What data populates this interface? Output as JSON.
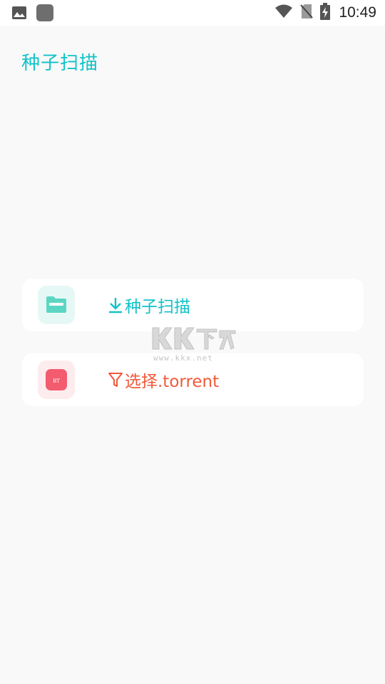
{
  "status_bar": {
    "time": "10:49",
    "icons": [
      "image-icon",
      "app-square-icon",
      "wifi-icon",
      "no-sim-icon",
      "battery-charging-icon"
    ]
  },
  "app": {
    "title": "种子扫描"
  },
  "actions": [
    {
      "label": "种子扫描",
      "icon": "folder-icon",
      "prefix_icon": "download-icon",
      "color": "#12c2c8"
    },
    {
      "label": "选择.torrent",
      "icon": "bt-icon",
      "icon_text": "BT",
      "prefix_icon": "filter-icon",
      "color": "#f2593a"
    }
  ],
  "watermark": {
    "text": "KK下载",
    "url": "www.kkx.net"
  }
}
